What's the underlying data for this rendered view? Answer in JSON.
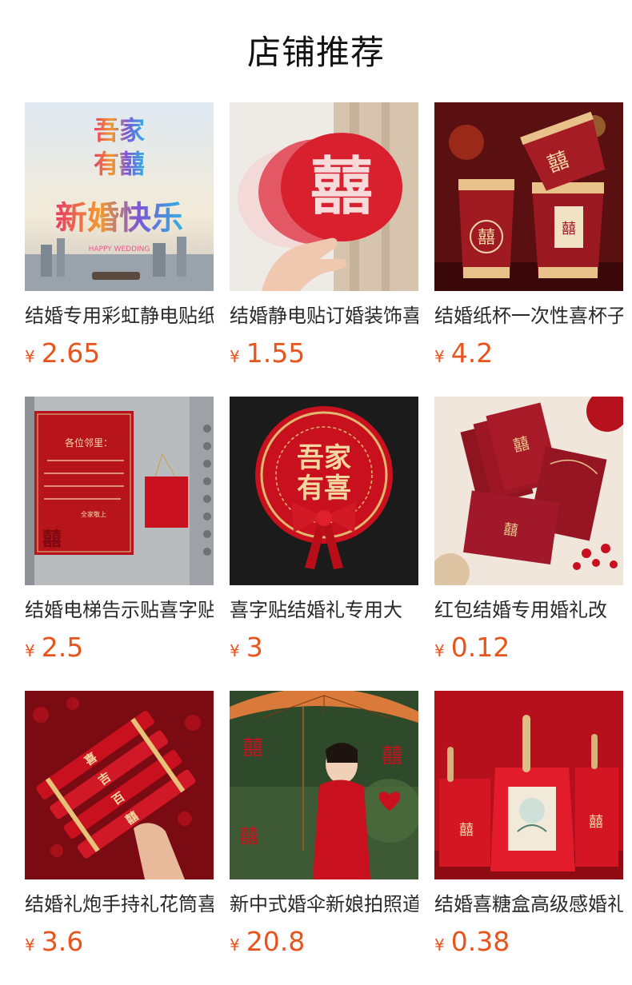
{
  "section_title": "店铺推荐",
  "currency_symbol": "¥",
  "products": [
    {
      "name": "结婚专用彩虹静电贴纸",
      "price": "2.65",
      "image_text": [
        "吾家",
        "有囍",
        "新婚快乐",
        "HAPPY WEDDING"
      ]
    },
    {
      "name": "结婚静电贴订婚装饰喜字",
      "price": "1.55",
      "image_text": [
        "囍"
      ]
    },
    {
      "name": "结婚纸杯一次性喜杯子",
      "price": "4.2",
      "image_text": [
        "囍",
        "囍",
        "囍"
      ]
    },
    {
      "name": "结婚电梯告示贴喜字贴",
      "price": "2.5",
      "image_text": [
        "各位邻里：",
        "囍",
        "全家敬上"
      ]
    },
    {
      "name": "喜字贴结婚礼专用大",
      "price": "3",
      "image_text": [
        "吾家",
        "有喜"
      ]
    },
    {
      "name": "红包结婚专用婚礼改",
      "price": "0.12",
      "image_text": [
        "囍",
        "囍"
      ]
    },
    {
      "name": "结婚礼炮手持礼花筒喜",
      "price": "3.6",
      "image_text": [
        "喜",
        "吉",
        "百",
        "囍"
      ]
    },
    {
      "name": "新中式婚伞新娘拍照道",
      "price": "20.8",
      "image_text": [
        "囍",
        "囍",
        "囍"
      ]
    },
    {
      "name": "结婚喜糖盒高级感婚礼",
      "price": "0.38",
      "image_text": [
        "囍",
        "囍"
      ]
    }
  ],
  "colors": {
    "accent_price": "#e8541e",
    "wedding_red": "#c8102e",
    "gold": "#d9b36c"
  }
}
